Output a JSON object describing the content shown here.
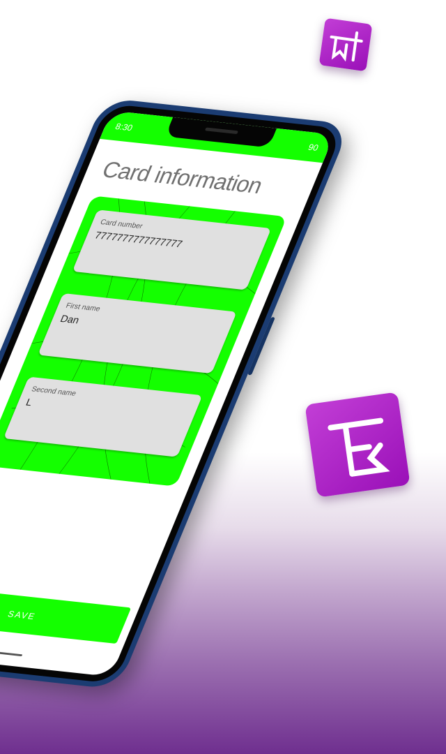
{
  "status": {
    "time": "8:30",
    "battery": "90"
  },
  "screen": {
    "title": "Card information",
    "fields": [
      {
        "label": "Card number",
        "value": "7777777777777777"
      },
      {
        "label": "First name",
        "value": "Dan"
      },
      {
        "label": "Second name",
        "value": "L"
      }
    ],
    "save_label": "SAVE"
  },
  "colors": {
    "accent": "#14ff00",
    "icon_purple": "#9a10b8",
    "phone_frame": "#1b3c72"
  }
}
